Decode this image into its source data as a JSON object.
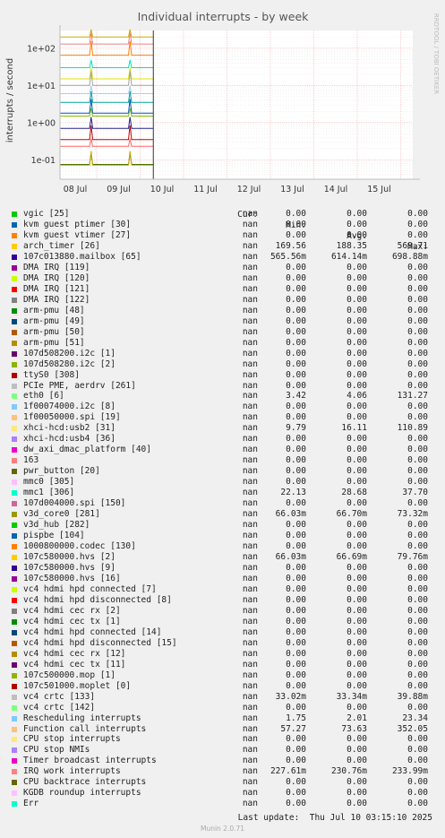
{
  "chart_data": {
    "type": "line",
    "title": "Individual interrupts - by week",
    "ylabel": "interrupts / second",
    "yscale": "log",
    "ylim": [
      0.03,
      300
    ],
    "yticks": [
      {
        "v": 0.1,
        "label": "1e-01"
      },
      {
        "v": 1,
        "label": "1e+00"
      },
      {
        "v": 10,
        "label": "1e+01"
      },
      {
        "v": 100,
        "label": "1e+02"
      }
    ],
    "xticks": [
      "08 Jul",
      "09 Jul",
      "10 Jul",
      "11 Jul",
      "12 Jul",
      "13 Jul",
      "14 Jul",
      "15 Jul"
    ],
    "x_data_range": [
      0,
      2.15
    ],
    "watermark": "RRDTOOL / TOBI OETIKER",
    "traces": [
      {
        "color": "#ccaa00",
        "value": 200
      },
      {
        "color": "#f08080",
        "value": 130
      },
      {
        "color": "#ff8000",
        "value": 65
      },
      {
        "color": "#00e0c0",
        "value": 30
      },
      {
        "color": "#e0e000",
        "value": 15
      },
      {
        "color": "#a0a0a0",
        "value": 10
      },
      {
        "color": "#b0c8f0",
        "value": 6
      },
      {
        "color": "#00a0a0",
        "value": 3.5
      },
      {
        "color": "#0050c0",
        "value": 1.8
      },
      {
        "color": "#80c000",
        "value": 1.5
      },
      {
        "color": "#202090",
        "value": 0.7
      },
      {
        "color": "#c00000",
        "value": 0.35
      },
      {
        "color": "#ff6060",
        "value": 0.23
      },
      {
        "color": "#206000",
        "value": 0.075
      },
      {
        "color": "#ccaa00",
        "value": 0.072
      }
    ]
  },
  "legend": {
    "headers": {
      "cur": "Cur:",
      "min": "Min:",
      "avg": "Avg:",
      "max": "Max:"
    },
    "rows": [
      {
        "name": "vgic [25]",
        "color": "#00cc00",
        "cur": "nan",
        "min": "0.00",
        "avg": "0.00",
        "max": "0.00"
      },
      {
        "name": "kvm guest ptimer [30]",
        "color": "#0066b3",
        "cur": "nan",
        "min": "0.00",
        "avg": "0.00",
        "max": "0.00"
      },
      {
        "name": "kvm guest vtimer [27]",
        "color": "#ff8000",
        "cur": "nan",
        "min": "0.00",
        "avg": "0.00",
        "max": "0.00"
      },
      {
        "name": "arch_timer [26]",
        "color": "#ffcc00",
        "cur": "nan",
        "min": "169.56",
        "avg": "188.35",
        "max": "569.71"
      },
      {
        "name": "107c013880.mailbox [65]",
        "color": "#330099",
        "cur": "nan",
        "min": "565.56m",
        "avg": "614.14m",
        "max": "698.88m"
      },
      {
        "name": "DMA IRQ [119]",
        "color": "#990099",
        "cur": "nan",
        "min": "0.00",
        "avg": "0.00",
        "max": "0.00"
      },
      {
        "name": "DMA IRQ [120]",
        "color": "#ccff00",
        "cur": "nan",
        "min": "0.00",
        "avg": "0.00",
        "max": "0.00"
      },
      {
        "name": "DMA IRQ [121]",
        "color": "#ff0000",
        "cur": "nan",
        "min": "0.00",
        "avg": "0.00",
        "max": "0.00"
      },
      {
        "name": "DMA IRQ [122]",
        "color": "#808080",
        "cur": "nan",
        "min": "0.00",
        "avg": "0.00",
        "max": "0.00"
      },
      {
        "name": "arm-pmu [48]",
        "color": "#008f00",
        "cur": "nan",
        "min": "0.00",
        "avg": "0.00",
        "max": "0.00"
      },
      {
        "name": "arm-pmu [49]",
        "color": "#00487d",
        "cur": "nan",
        "min": "0.00",
        "avg": "0.00",
        "max": "0.00"
      },
      {
        "name": "arm-pmu [50]",
        "color": "#b35a00",
        "cur": "nan",
        "min": "0.00",
        "avg": "0.00",
        "max": "0.00"
      },
      {
        "name": "arm-pmu [51]",
        "color": "#b38f00",
        "cur": "nan",
        "min": "0.00",
        "avg": "0.00",
        "max": "0.00"
      },
      {
        "name": "107d508200.i2c [1]",
        "color": "#6b006b",
        "cur": "nan",
        "min": "0.00",
        "avg": "0.00",
        "max": "0.00"
      },
      {
        "name": "107d508280.i2c [2]",
        "color": "#8fb300",
        "cur": "nan",
        "min": "0.00",
        "avg": "0.00",
        "max": "0.00"
      },
      {
        "name": "ttyS0 [308]",
        "color": "#b30000",
        "cur": "nan",
        "min": "0.00",
        "avg": "0.00",
        "max": "0.00"
      },
      {
        "name": "PCIe PME, aerdrv [261]",
        "color": "#bebebe",
        "cur": "nan",
        "min": "0.00",
        "avg": "0.00",
        "max": "0.00"
      },
      {
        "name": "eth0 [6]",
        "color": "#80ff80",
        "cur": "nan",
        "min": "3.42",
        "avg": "4.06",
        "max": "131.27"
      },
      {
        "name": "1f00074000.i2c [8]",
        "color": "#80c9ff",
        "cur": "nan",
        "min": "0.00",
        "avg": "0.00",
        "max": "0.00"
      },
      {
        "name": "1f00050000.spi [19]",
        "color": "#ffc080",
        "cur": "nan",
        "min": "0.00",
        "avg": "0.00",
        "max": "0.00"
      },
      {
        "name": "xhci-hcd:usb2 [31]",
        "color": "#ffe680",
        "cur": "nan",
        "min": "9.79",
        "avg": "16.11",
        "max": "110.89"
      },
      {
        "name": "xhci-hcd:usb4 [36]",
        "color": "#aa80ff",
        "cur": "nan",
        "min": "0.00",
        "avg": "0.00",
        "max": "0.00"
      },
      {
        "name": "dw_axi_dmac_platform [40]",
        "color": "#ee00cc",
        "cur": "nan",
        "min": "0.00",
        "avg": "0.00",
        "max": "0.00"
      },
      {
        "name": "163",
        "color": "#ff8080",
        "cur": "nan",
        "min": "0.00",
        "avg": "0.00",
        "max": "0.00"
      },
      {
        "name": "pwr_button [20]",
        "color": "#666600",
        "cur": "nan",
        "min": "0.00",
        "avg": "0.00",
        "max": "0.00"
      },
      {
        "name": "mmc0 [305]",
        "color": "#ffbfff",
        "cur": "nan",
        "min": "0.00",
        "avg": "0.00",
        "max": "0.00"
      },
      {
        "name": "mmc1 [306]",
        "color": "#00ffcc",
        "cur": "nan",
        "min": "22.13",
        "avg": "28.68",
        "max": "37.70"
      },
      {
        "name": "107d004000.spi [150]",
        "color": "#cc6699",
        "cur": "nan",
        "min": "0.00",
        "avg": "0.00",
        "max": "0.00"
      },
      {
        "name": "v3d_core0 [281]",
        "color": "#999900",
        "cur": "nan",
        "min": "66.03m",
        "avg": "66.70m",
        "max": "73.32m"
      },
      {
        "name": "v3d_hub [282]",
        "color": "#00cc00",
        "cur": "nan",
        "min": "0.00",
        "avg": "0.00",
        "max": "0.00"
      },
      {
        "name": "pispbe [104]",
        "color": "#0066b3",
        "cur": "nan",
        "min": "0.00",
        "avg": "0.00",
        "max": "0.00"
      },
      {
        "name": "1000800000.codec [130]",
        "color": "#ff8000",
        "cur": "nan",
        "min": "0.00",
        "avg": "0.00",
        "max": "0.00"
      },
      {
        "name": "107c580000.hvs [2]",
        "color": "#ffcc00",
        "cur": "nan",
        "min": "66.03m",
        "avg": "66.69m",
        "max": "79.76m"
      },
      {
        "name": "107c580000.hvs [9]",
        "color": "#330099",
        "cur": "nan",
        "min": "0.00",
        "avg": "0.00",
        "max": "0.00"
      },
      {
        "name": "107c580000.hvs [16]",
        "color": "#990099",
        "cur": "nan",
        "min": "0.00",
        "avg": "0.00",
        "max": "0.00"
      },
      {
        "name": "vc4 hdmi hpd connected [7]",
        "color": "#ccff00",
        "cur": "nan",
        "min": "0.00",
        "avg": "0.00",
        "max": "0.00"
      },
      {
        "name": "vc4 hdmi hpd disconnected [8]",
        "color": "#ff0000",
        "cur": "nan",
        "min": "0.00",
        "avg": "0.00",
        "max": "0.00"
      },
      {
        "name": "vc4 hdmi cec rx [2]",
        "color": "#808080",
        "cur": "nan",
        "min": "0.00",
        "avg": "0.00",
        "max": "0.00"
      },
      {
        "name": "vc4 hdmi cec tx [1]",
        "color": "#008f00",
        "cur": "nan",
        "min": "0.00",
        "avg": "0.00",
        "max": "0.00"
      },
      {
        "name": "vc4 hdmi hpd connected [14]",
        "color": "#00487d",
        "cur": "nan",
        "min": "0.00",
        "avg": "0.00",
        "max": "0.00"
      },
      {
        "name": "vc4 hdmi hpd disconnected [15]",
        "color": "#b35a00",
        "cur": "nan",
        "min": "0.00",
        "avg": "0.00",
        "max": "0.00"
      },
      {
        "name": "vc4 hdmi cec rx [12]",
        "color": "#b38f00",
        "cur": "nan",
        "min": "0.00",
        "avg": "0.00",
        "max": "0.00"
      },
      {
        "name": "vc4 hdmi cec tx [11]",
        "color": "#6b006b",
        "cur": "nan",
        "min": "0.00",
        "avg": "0.00",
        "max": "0.00"
      },
      {
        "name": "107c500000.mop [1]",
        "color": "#8fb300",
        "cur": "nan",
        "min": "0.00",
        "avg": "0.00",
        "max": "0.00"
      },
      {
        "name": "107c501000.moplet [0]",
        "color": "#b30000",
        "cur": "nan",
        "min": "0.00",
        "avg": "0.00",
        "max": "0.00"
      },
      {
        "name": "vc4 crtc [133]",
        "color": "#bebebe",
        "cur": "nan",
        "min": "33.02m",
        "avg": "33.34m",
        "max": "39.88m"
      },
      {
        "name": "vc4 crtc [142]",
        "color": "#80ff80",
        "cur": "nan",
        "min": "0.00",
        "avg": "0.00",
        "max": "0.00"
      },
      {
        "name": "Rescheduling interrupts",
        "color": "#80c9ff",
        "cur": "nan",
        "min": "1.75",
        "avg": "2.01",
        "max": "23.34"
      },
      {
        "name": "Function call interrupts",
        "color": "#ffc080",
        "cur": "nan",
        "min": "57.27",
        "avg": "73.63",
        "max": "352.05"
      },
      {
        "name": "CPU stop interrupts",
        "color": "#ffe680",
        "cur": "nan",
        "min": "0.00",
        "avg": "0.00",
        "max": "0.00"
      },
      {
        "name": "CPU stop NMIs",
        "color": "#aa80ff",
        "cur": "nan",
        "min": "0.00",
        "avg": "0.00",
        "max": "0.00"
      },
      {
        "name": "Timer broadcast interrupts",
        "color": "#ee00cc",
        "cur": "nan",
        "min": "0.00",
        "avg": "0.00",
        "max": "0.00"
      },
      {
        "name": "IRQ work interrupts",
        "color": "#ff8080",
        "cur": "nan",
        "min": "227.61m",
        "avg": "230.76m",
        "max": "233.99m"
      },
      {
        "name": "CPU backtrace interrupts",
        "color": "#666600",
        "cur": "nan",
        "min": "0.00",
        "avg": "0.00",
        "max": "0.00"
      },
      {
        "name": "KGDB roundup interrupts",
        "color": "#ffbfff",
        "cur": "nan",
        "min": "0.00",
        "avg": "0.00",
        "max": "0.00"
      },
      {
        "name": "Err",
        "color": "#00ffcc",
        "cur": "nan",
        "min": "0.00",
        "avg": "0.00",
        "max": "0.00"
      }
    ]
  },
  "footer": {
    "last_update": "Last update:  Thu Jul 10 03:15:10 2025",
    "version": "Munin 2.0.71"
  }
}
